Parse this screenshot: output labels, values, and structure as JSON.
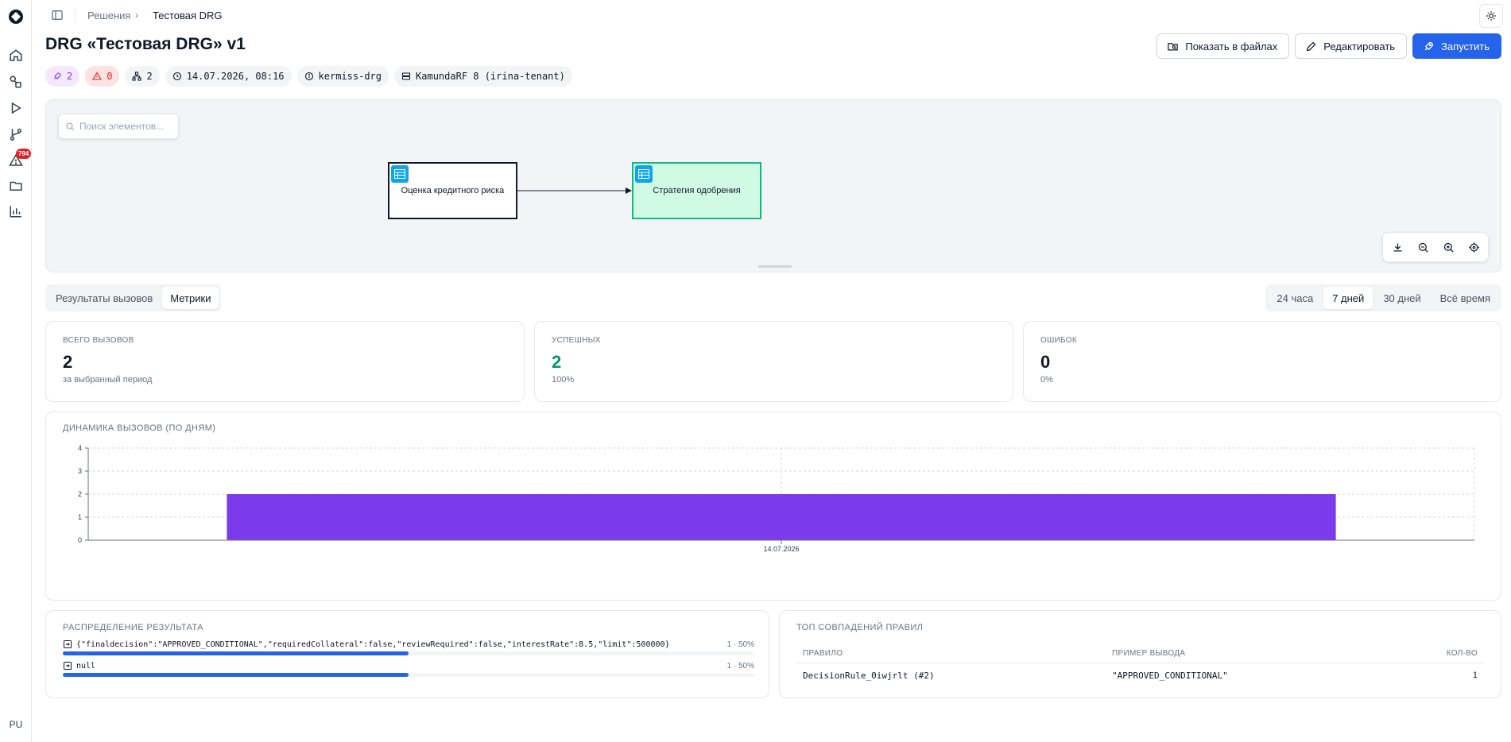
{
  "sidebar": {
    "items": [
      {
        "icon": "home-icon"
      },
      {
        "icon": "shapes-icon"
      },
      {
        "icon": "play-icon"
      },
      {
        "icon": "git-branch-icon"
      },
      {
        "icon": "alert-triangle-icon",
        "badge": "794"
      },
      {
        "icon": "folder-icon"
      },
      {
        "icon": "bar-chart-icon"
      }
    ],
    "avatar": "PU"
  },
  "breadcrumb": {
    "parent": "Решения",
    "separator": "›",
    "current": "Тестовая DRG"
  },
  "header": {
    "title": "DRG «Тестовая DRG» v1",
    "actions": {
      "show_files": "Показать в файлах",
      "edit": "Редактировать",
      "run": "Запустить"
    }
  },
  "chips": {
    "deploys": "2",
    "errors": "0",
    "nodes": "2",
    "datetime": "14.07.2026, 08:16",
    "id": "kermiss-drg",
    "engine": "KamundaRF 8 (irina-tenant)"
  },
  "diagram": {
    "search_placeholder": "Поиск элементов...",
    "nodes": [
      {
        "label": "Оценка кредитного риска",
        "highlighted": false
      },
      {
        "label": "Стратегия одобрения",
        "highlighted": true
      }
    ]
  },
  "tabs": {
    "results": "Результаты вызовов",
    "metrics": "Метрики",
    "active": "Метрики"
  },
  "periods": {
    "p24h": "24 часа",
    "p7d": "7 дней",
    "p30d": "30 дней",
    "all": "Всё время",
    "active": "7 дней"
  },
  "stats": {
    "total": {
      "label": "Всего вызовов",
      "value": "2",
      "sub": "за выбранный период"
    },
    "success": {
      "label": "Успешных",
      "value": "2",
      "sub": "100%"
    },
    "errors": {
      "label": "Ошибок",
      "value": "0",
      "sub": "0%"
    }
  },
  "chart_title": "Динамика вызовов (по дням)",
  "chart_data": {
    "type": "bar",
    "categories": [
      "14.07.2026"
    ],
    "values": [
      2
    ],
    "title": "Динамика вызовов (по дням)",
    "xlabel": "",
    "ylabel": "",
    "ylim": [
      0,
      4
    ],
    "yticks": [
      "0",
      "1",
      "2",
      "3",
      "4"
    ],
    "grid": true,
    "color": "#7c3aed"
  },
  "distribution": {
    "title": "Распределение результата",
    "rows": [
      {
        "value": "{\"finaldecision\":\"APPROVED_CONDITIONAL\",\"requiredCollateral\":false,\"reviewRequired\":false,\"interestRate\":8.5,\"limit\":500000}",
        "count": "1 · 50%",
        "fraction": 0.5
      },
      {
        "value": "null",
        "count": "1 · 50%",
        "fraction": 0.5
      }
    ]
  },
  "rules": {
    "title": "Топ совпадений правил",
    "columns": {
      "rule": "Правило",
      "example": "Пример вывода",
      "count": "Кол-во"
    },
    "rows": [
      {
        "rule": "DecisionRule_0iwjrlt (#2)",
        "example": "\"APPROVED_CONDITIONAL\"",
        "count": "1"
      }
    ]
  },
  "colors": {
    "primary": "#2563eb",
    "bar": "#7c3aed",
    "success": "#059669",
    "danger": "#dc2626",
    "node_highlight": "#10b981"
  }
}
